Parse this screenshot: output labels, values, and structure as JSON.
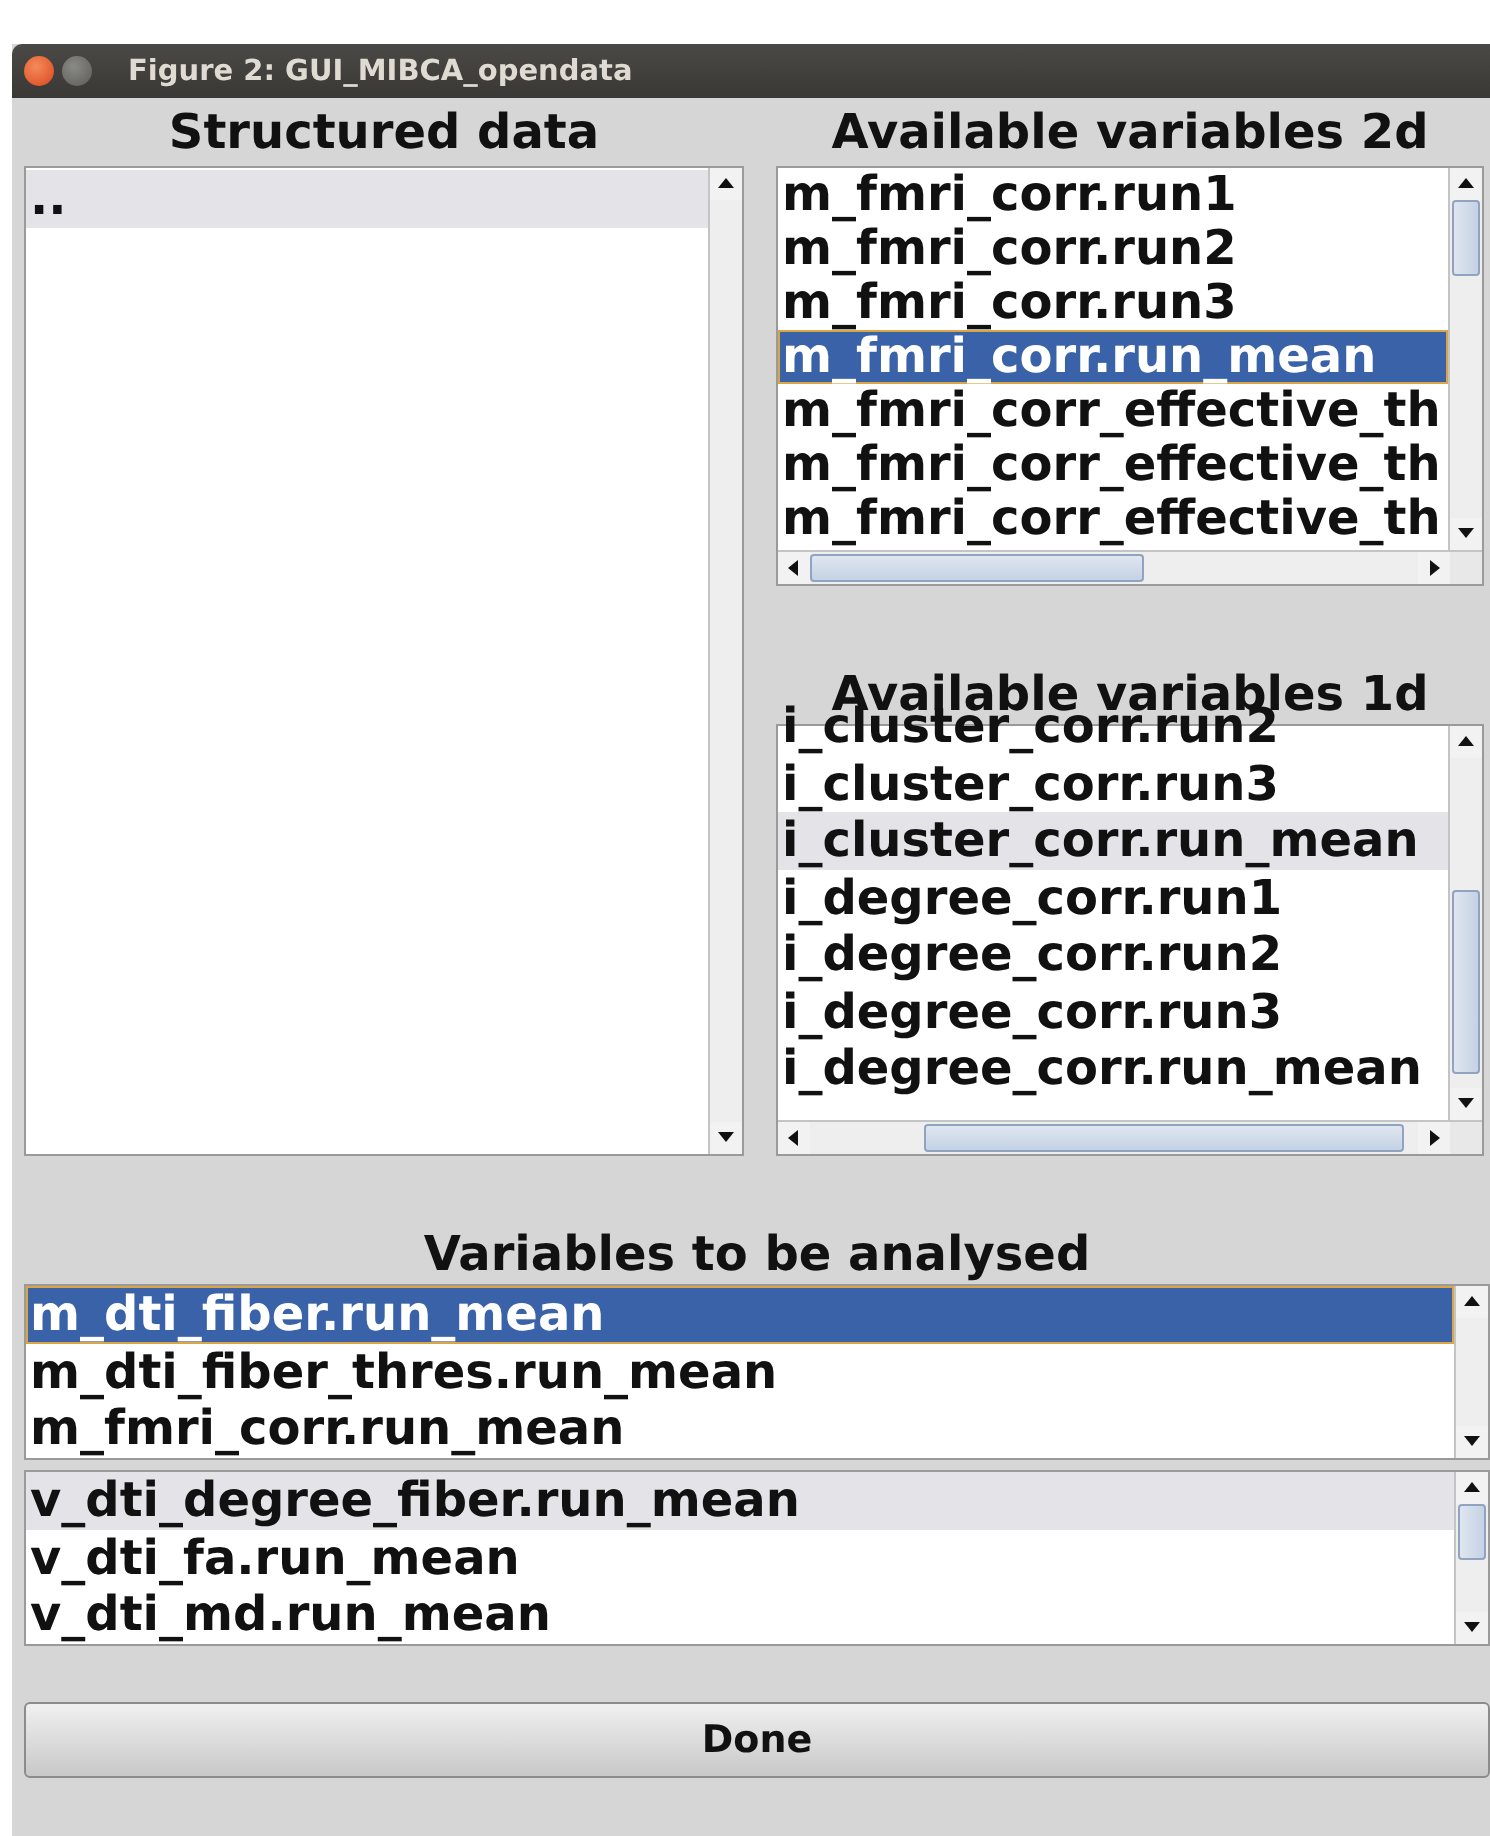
{
  "window": {
    "title": "Figure 2: GUI_MIBCA_opendata"
  },
  "structured_data": {
    "heading": "Structured data",
    "items": [
      {
        "label": "..",
        "selected": false,
        "focused": true
      }
    ]
  },
  "available_2d": {
    "heading": "Available variables 2d",
    "items": [
      {
        "label": "m_fmri_corr.run1",
        "selected": false,
        "focused": false
      },
      {
        "label": "m_fmri_corr.run2",
        "selected": false,
        "focused": false
      },
      {
        "label": "m_fmri_corr.run3",
        "selected": false,
        "focused": false
      },
      {
        "label": "m_fmri_corr.run_mean",
        "selected": true,
        "focused": false
      },
      {
        "label": "m_fmri_corr_effective_th",
        "selected": false,
        "focused": false
      },
      {
        "label": "m_fmri_corr_effective_th",
        "selected": false,
        "focused": false
      },
      {
        "label": "m_fmri_corr_effective_th",
        "selected": false,
        "focused": false
      }
    ]
  },
  "available_1d": {
    "heading": "Available variables 1d",
    "items": [
      {
        "label": "i_cluster_corr.run2",
        "selected": false,
        "focused": false
      },
      {
        "label": "i_cluster_corr.run3",
        "selected": false,
        "focused": false
      },
      {
        "label": "i_cluster_corr.run_mean",
        "selected": false,
        "focused": true
      },
      {
        "label": "i_degree_corr.run1",
        "selected": false,
        "focused": false
      },
      {
        "label": "i_degree_corr.run2",
        "selected": false,
        "focused": false
      },
      {
        "label": "i_degree_corr.run3",
        "selected": false,
        "focused": false
      },
      {
        "label": "i_degree_corr.run_mean",
        "selected": false,
        "focused": false
      }
    ]
  },
  "to_analyse": {
    "heading": "Variables to be analysed",
    "lists": [
      {
        "items": [
          {
            "label": "m_dti_fiber.run_mean",
            "selected": true,
            "focused": false
          },
          {
            "label": "m_dti_fiber_thres.run_mean",
            "selected": false,
            "focused": false
          },
          {
            "label": "m_fmri_corr.run_mean",
            "selected": false,
            "focused": false
          }
        ]
      },
      {
        "items": [
          {
            "label": "v_dti_degree_fiber.run_mean",
            "selected": false,
            "focused": true
          },
          {
            "label": "v_dti_fa.run_mean",
            "selected": false,
            "focused": false
          },
          {
            "label": "v_dti_md.run_mean",
            "selected": false,
            "focused": false
          }
        ]
      }
    ]
  },
  "done_button": {
    "label": "Done"
  }
}
